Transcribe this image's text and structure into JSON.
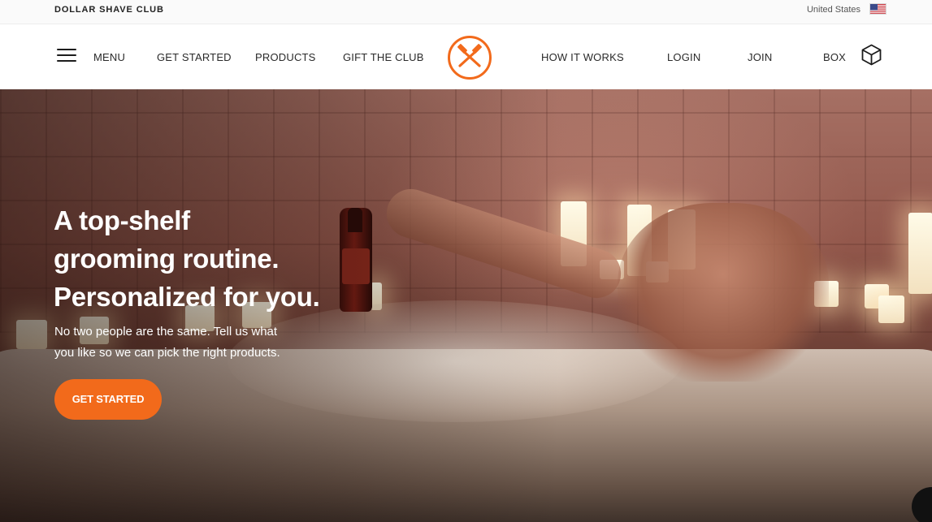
{
  "topbar": {
    "brand": "DOLLAR SHAVE CLUB",
    "country": "United States",
    "flag_icon": "us-flag-icon"
  },
  "nav": {
    "menu_icon": "hamburger-menu-icon",
    "menu": "MENU",
    "get_started": "GET STARTED",
    "products": "PRODUCTS",
    "gift": "GIFT THE CLUB",
    "logo_icon": "crossed-razors-logo-icon",
    "how_it_works": "HOW IT WORKS",
    "login": "LOGIN",
    "join": "JOIN",
    "box": "BOX",
    "box_icon": "box-cube-icon"
  },
  "hero": {
    "title_lines": [
      "A top-shelf",
      "grooming routine.",
      "Personalized for you."
    ],
    "subtitle_lines": [
      "No two people are the same. Tell us what",
      "you like so we can pick the right products."
    ],
    "cta": "GET STARTED",
    "chat_icon": "chat-bubble-icon"
  },
  "colors": {
    "accent": "#f26a1b",
    "text": "#1c1c1c",
    "hero_text": "#ffffff"
  }
}
